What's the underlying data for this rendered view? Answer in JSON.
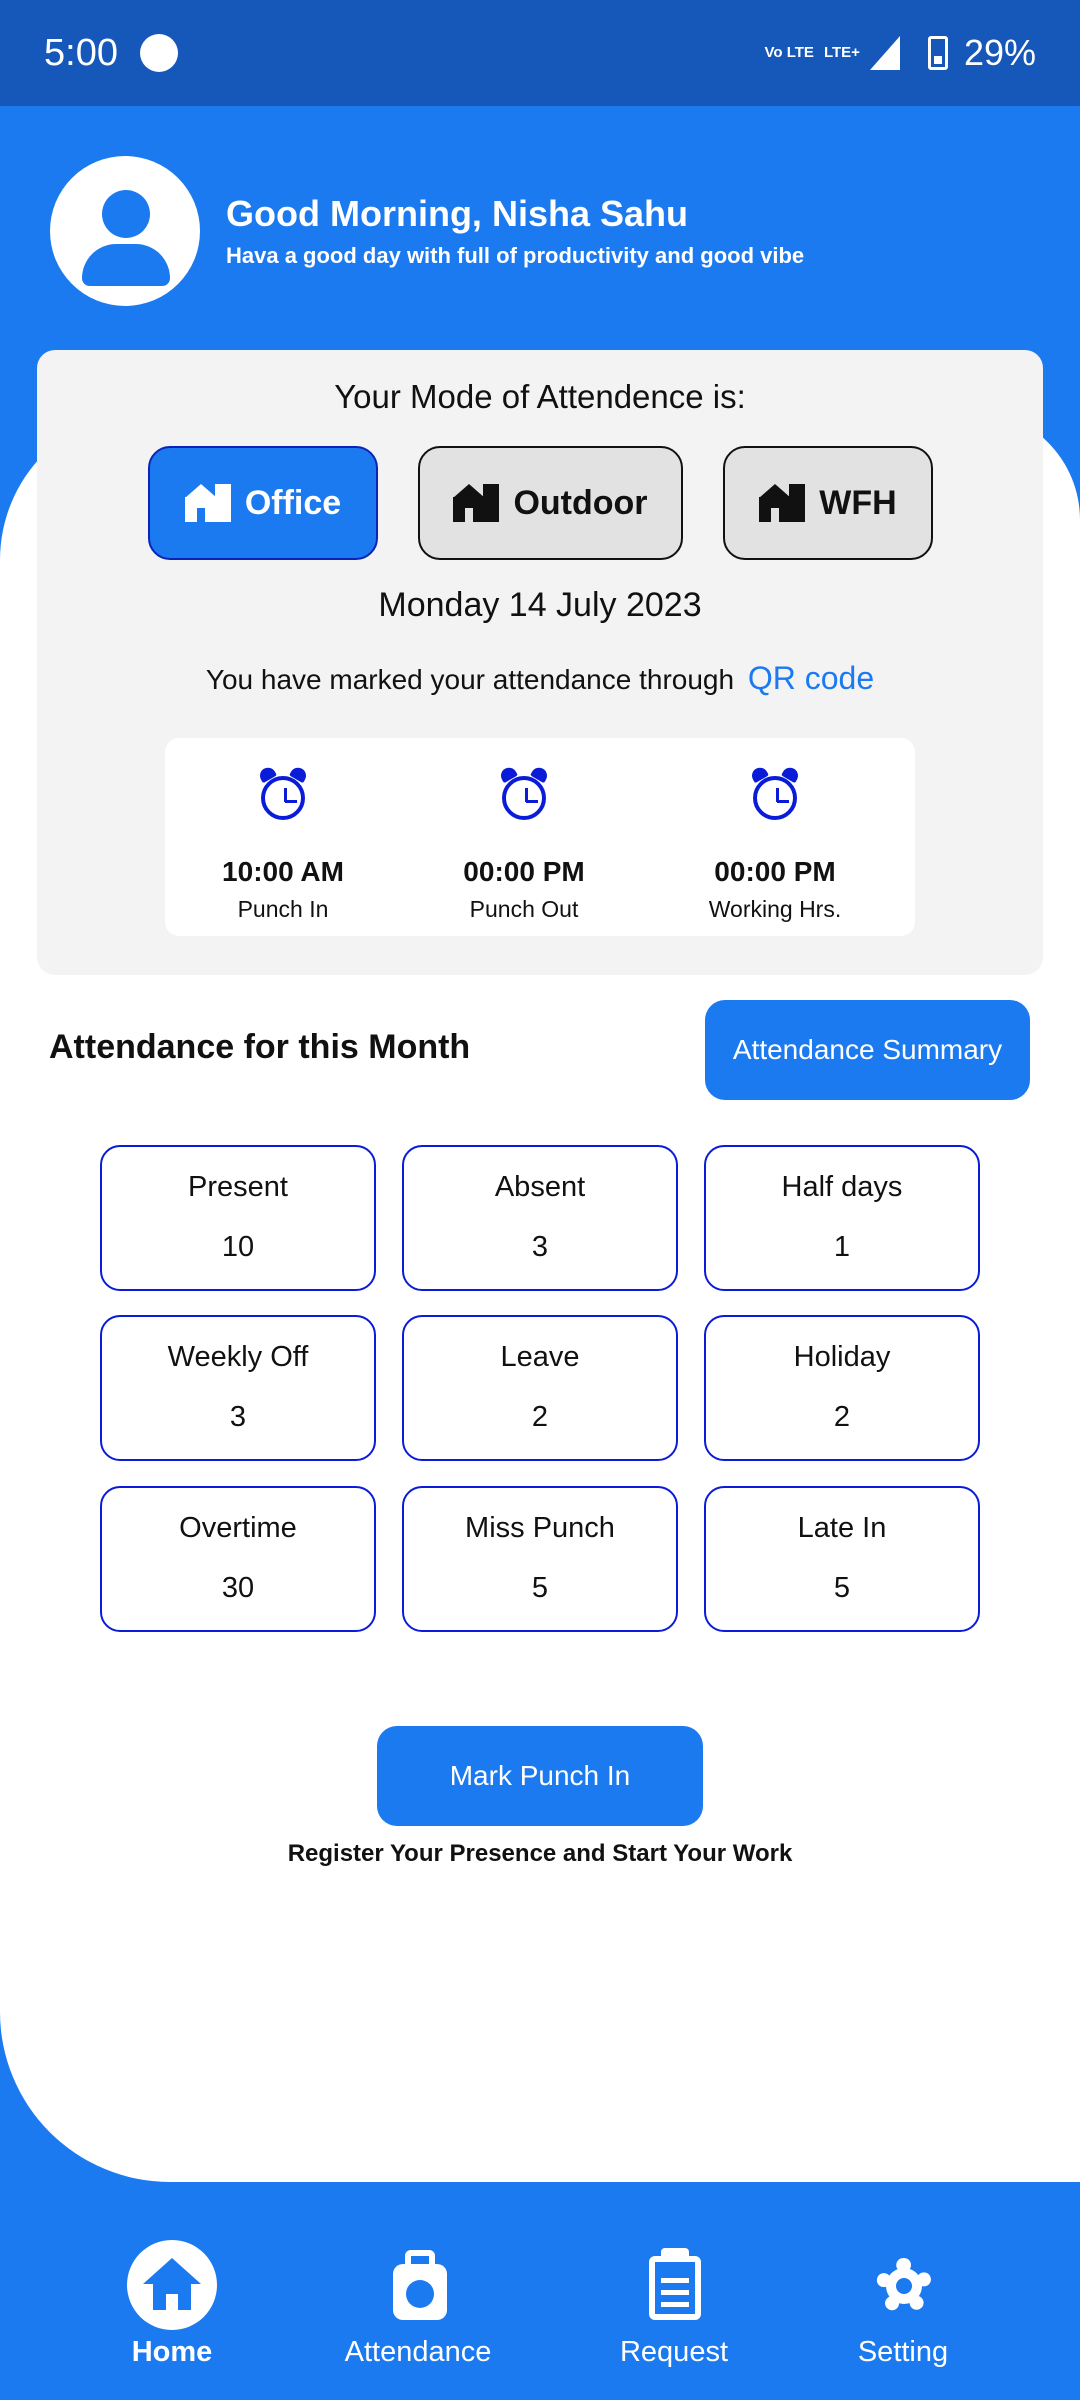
{
  "status_bar": {
    "time": "5:00",
    "network1": "Vo LTE",
    "network2": "LTE+",
    "battery": "29%"
  },
  "header": {
    "greeting": "Good Morning, Nisha Sahu",
    "subtitle": "Hava a good day with full of productivity and good vibe"
  },
  "mode": {
    "title": "Your Mode of Attendence is:",
    "options": [
      {
        "label": "Office",
        "active": true
      },
      {
        "label": "Outdoor",
        "active": false
      },
      {
        "label": "WFH",
        "active": false
      }
    ],
    "date": "Monday 14 July 2023",
    "marked_text": "You have marked your attendance through",
    "marked_method": "QR code"
  },
  "punch": [
    {
      "time": "10:00 AM",
      "label": "Punch In"
    },
    {
      "time": "00:00 PM",
      "label": "Punch Out"
    },
    {
      "time": "00:00 PM",
      "label": "Working Hrs."
    }
  ],
  "month": {
    "title": "Attendance for this Month",
    "summary_button": "Attendance Summary",
    "stats": [
      {
        "label": "Present",
        "value": "10"
      },
      {
        "label": "Absent",
        "value": "3"
      },
      {
        "label": "Half days",
        "value": "1"
      },
      {
        "label": "Weekly Off",
        "value": "3"
      },
      {
        "label": "Leave",
        "value": "2"
      },
      {
        "label": "Holiday",
        "value": "2"
      },
      {
        "label": "Overtime",
        "value": "30"
      },
      {
        "label": "Miss Punch",
        "value": "5"
      },
      {
        "label": "Late In",
        "value": "5"
      }
    ]
  },
  "action": {
    "button": "Mark Punch In",
    "caption": "Register Your Presence and Start Your Work"
  },
  "nav": {
    "items": [
      {
        "label": "Home",
        "icon": "home-icon",
        "active": true
      },
      {
        "label": "Attendance",
        "icon": "briefcase-clock-icon",
        "active": false
      },
      {
        "label": "Request",
        "icon": "clipboard-icon",
        "active": false
      },
      {
        "label": "Setting",
        "icon": "gear-icon",
        "active": false
      }
    ]
  },
  "colors": {
    "primary": "#1c7af0",
    "status_bar": "#1558ba",
    "accent_border": "#0b1cd8"
  }
}
